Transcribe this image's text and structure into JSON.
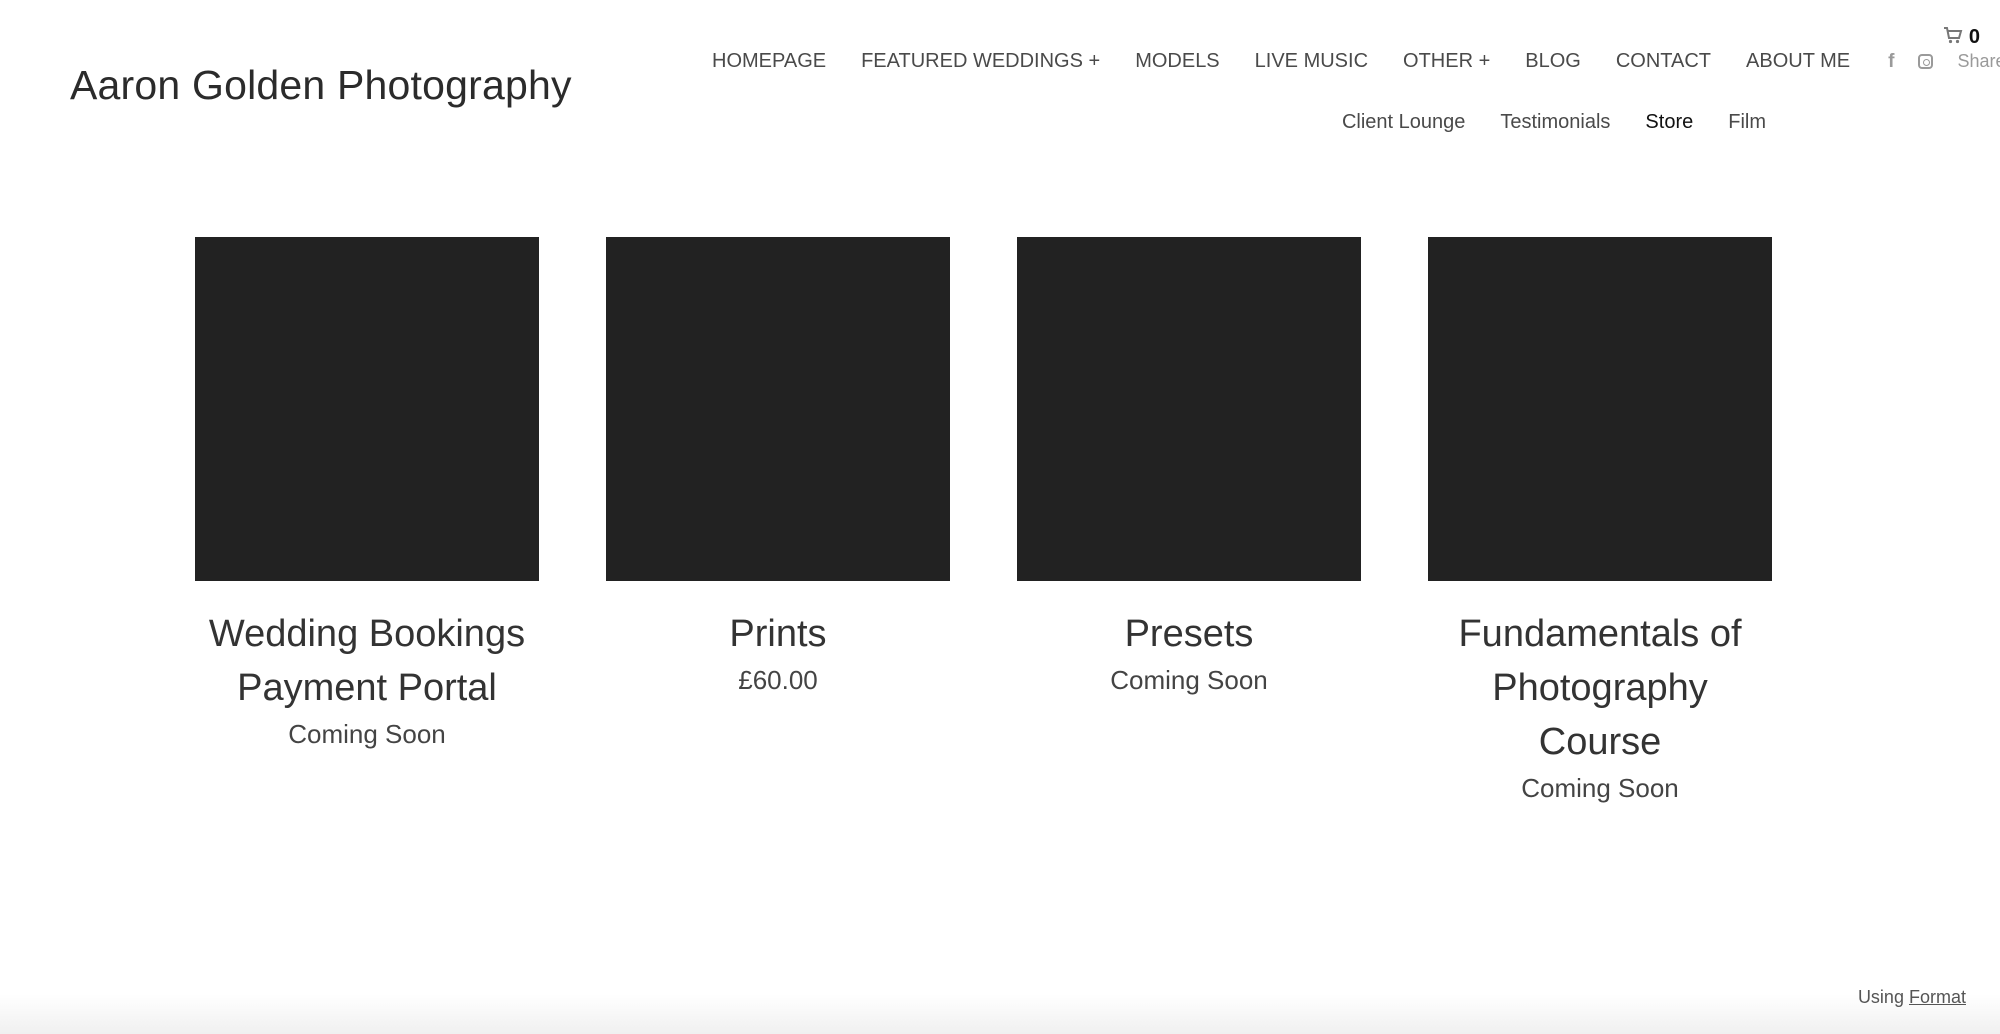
{
  "site": {
    "title": "Aaron Golden Photography"
  },
  "nav": {
    "primary": [
      {
        "label": "HOMEPAGE"
      },
      {
        "label": "FEATURED WEDDINGS +"
      },
      {
        "label": "MODELS"
      },
      {
        "label": "LIVE MUSIC"
      },
      {
        "label": "OTHER +"
      },
      {
        "label": "BLOG"
      },
      {
        "label": "CONTACT"
      },
      {
        "label": "ABOUT ME"
      }
    ],
    "secondary": [
      {
        "label": "Client Lounge"
      },
      {
        "label": "Testimonials"
      },
      {
        "label": "Store",
        "active": true
      },
      {
        "label": "Film"
      }
    ],
    "social": {
      "facebook_icon": "facebook-icon",
      "instagram_icon": "instagram-icon",
      "share_label": "Share"
    }
  },
  "cart": {
    "icon": "cart-icon",
    "count": "0"
  },
  "products": [
    {
      "name": "Wedding Bookings Payment Portal",
      "price": "Coming Soon"
    },
    {
      "name": "Prints",
      "price": "£60.00"
    },
    {
      "name": "Presets",
      "price": "Coming Soon"
    },
    {
      "name": "Fundamentals of Photography Course",
      "price": "Coming Soon"
    }
  ],
  "footer": {
    "using_label": "Using",
    "format_link": "Format"
  }
}
